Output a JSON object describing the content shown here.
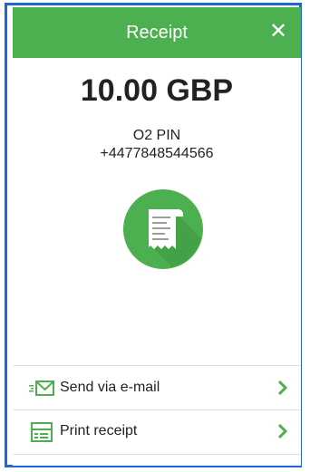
{
  "header": {
    "title": "Receipt",
    "close_label": "✕"
  },
  "amount": "10.00 GBP",
  "product": "O2 PIN",
  "phone": "+4477848544566",
  "actions": [
    {
      "label": "Send via e-mail",
      "icon": "email-icon"
    },
    {
      "label": "Print receipt",
      "icon": "print-icon"
    }
  ],
  "colors": {
    "accent": "#4caf50",
    "frame": "#1f67d9"
  }
}
